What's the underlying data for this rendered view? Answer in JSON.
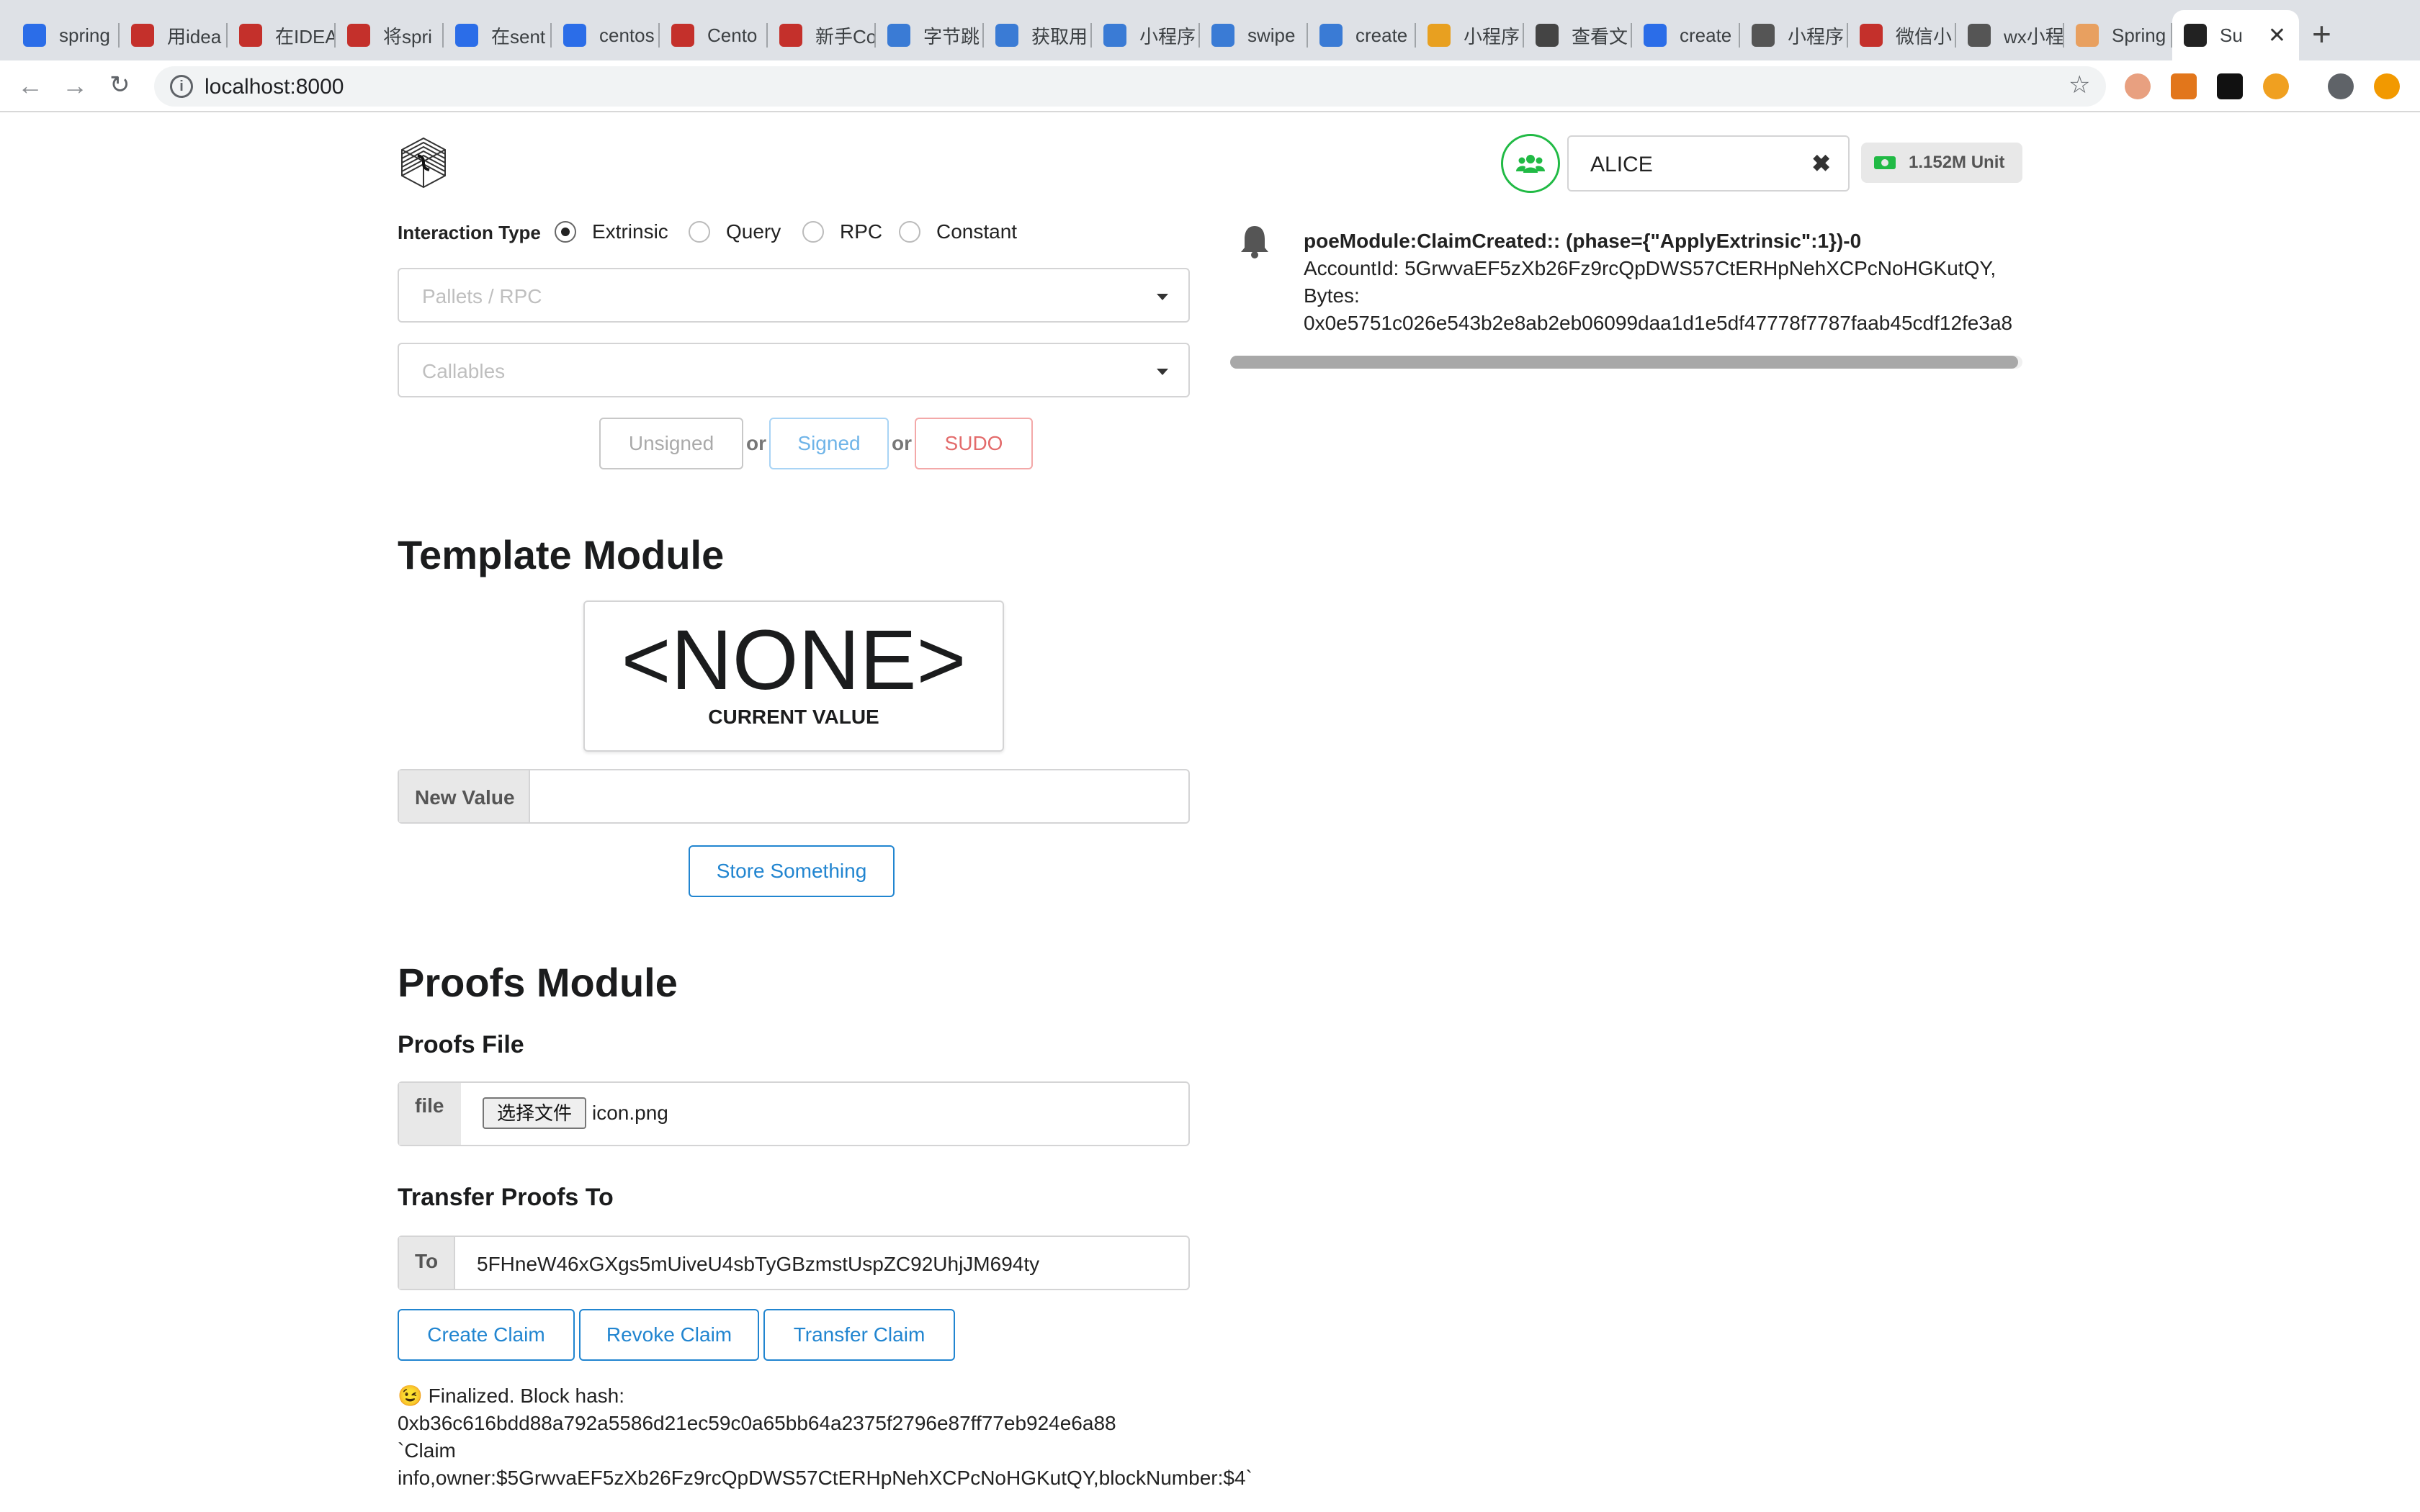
{
  "browser": {
    "tabs": [
      {
        "label": "spring",
        "icon": "paw-icon",
        "color": "#2b6de8"
      },
      {
        "label": "用idea",
        "icon": "c-logo-icon",
        "color": "#c4302b"
      },
      {
        "label": "在IDEA",
        "icon": "c-logo-icon",
        "color": "#c4302b"
      },
      {
        "label": "将spri",
        "icon": "c-logo-icon",
        "color": "#c4302b"
      },
      {
        "label": "在sent",
        "icon": "paw-icon",
        "color": "#2b6de8"
      },
      {
        "label": "centos",
        "icon": "paw-icon",
        "color": "#2b6de8"
      },
      {
        "label": "Cento",
        "icon": "c-logo-icon",
        "color": "#c4302b"
      },
      {
        "label": "新手Co",
        "icon": "c-logo-icon",
        "color": "#c4302b"
      },
      {
        "label": "字节跳",
        "icon": "swirl-icon",
        "color": "#3a7bd5"
      },
      {
        "label": "获取用",
        "icon": "swirl-icon",
        "color": "#3a7bd5"
      },
      {
        "label": "小程序",
        "icon": "swirl-icon",
        "color": "#3a7bd5"
      },
      {
        "label": "swipe",
        "icon": "swirl-icon",
        "color": "#3a7bd5"
      },
      {
        "label": "create",
        "icon": "swirl-icon",
        "color": "#3a7bd5"
      },
      {
        "label": "小程序",
        "icon": "grid-icon",
        "color": "#e8a020"
      },
      {
        "label": "查看文",
        "icon": "globe-icon",
        "color": "#444444"
      },
      {
        "label": "create",
        "icon": "paw-icon",
        "color": "#2b6de8"
      },
      {
        "label": "小程序",
        "icon": "wave-icon",
        "color": "#555555"
      },
      {
        "label": "微信小",
        "icon": "book-icon",
        "color": "#c4302b"
      },
      {
        "label": "wx小程",
        "icon": "wave-icon",
        "color": "#555555"
      },
      {
        "label": "Spring",
        "icon": "coin-icon",
        "color": "#e8a060"
      },
      {
        "label": "Su",
        "icon": "substrate-icon",
        "color": "#222222",
        "active": true
      }
    ],
    "url": "localhost:8000"
  },
  "account": {
    "name": "ALICE",
    "balance": "1.152M Unit"
  },
  "interaction": {
    "label": "Interaction Type",
    "options": [
      "Extrinsic",
      "Query",
      "RPC",
      "Constant"
    ],
    "selected": "Extrinsic",
    "pallets_placeholder": "Pallets / RPC",
    "callables_placeholder": "Callables",
    "unsigned_label": "Unsigned",
    "or_label": "or",
    "signed_label": "Signed",
    "sudo_label": "SUDO"
  },
  "template_module": {
    "title": "Template Module",
    "current_value": "<NONE>",
    "current_value_label": "CURRENT VALUE",
    "new_value_label": "New Value",
    "new_value": "",
    "store_button": "Store Something"
  },
  "proofs_module": {
    "title": "Proofs Module",
    "file_heading": "Proofs File",
    "file_label": "file",
    "choose_file_button": "选择文件",
    "file_name": "icon.png",
    "transfer_heading": "Transfer Proofs To",
    "to_label": "To",
    "to_value": "5FHneW46xGXgs5mUiveU4sbTyGBzmstUspZC92UhjJM694ty",
    "create_button": "Create Claim",
    "revoke_button": "Revoke Claim",
    "transfer_button": "Transfer Claim",
    "status_lines": [
      "😉 Finalized. Block hash:",
      "0xb36c616bdd88a792a5586d21ec59c0a65bb64a2375f2796e87ff77eb924e6a88",
      "`Claim",
      "info,owner:$5GrwvaEF5zXb26Fz9rcQpDWS57CtERHpNehXCPcNoHGKutQY,blockNumber:$4`"
    ]
  },
  "events": {
    "items": [
      {
        "title": "poeModule:ClaimCreated:: (phase={\"ApplyExtrinsic\":1})-0",
        "line1": "AccountId: 5GrwvaEF5zXb26Fz9rcQpDWS57CtERHpNehXCPcNoHGKutQY,",
        "line2": "Bytes:",
        "line3": "0x0e5751c026e543b2e8ab2eb06099daa1d1e5df47778f7787faab45cdf12fe3a8"
      }
    ]
  },
  "colors": {
    "accent_blue": "#2185d0",
    "green": "#21ba45",
    "sudo_red": "#db2828"
  }
}
